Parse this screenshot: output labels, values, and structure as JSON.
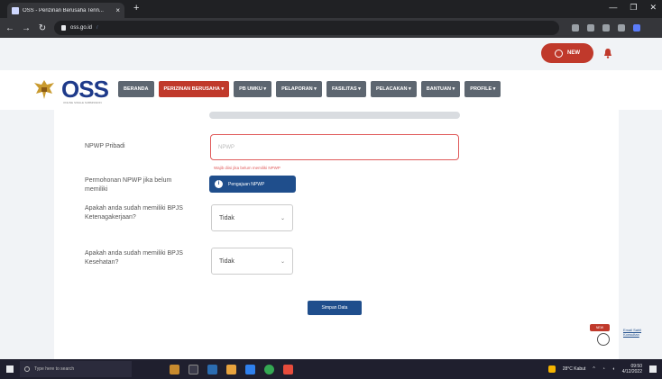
{
  "browser": {
    "tab_title": "OSS - Perizinan Berusaha Terin...",
    "url": "oss.go.id",
    "url_rest": "/"
  },
  "header": {
    "new_badge_label": "NEW",
    "logo_text": "OSS",
    "logo_subtitle": "ONLINE SINGLE SUBMISSION",
    "menu": [
      {
        "label": "BERANDA",
        "active": false
      },
      {
        "label": "PERIZINAN BERUSAHA",
        "active": true
      },
      {
        "label": "PB UMKU",
        "active": false
      },
      {
        "label": "PELAPORAN",
        "active": false
      },
      {
        "label": "FASILITAS",
        "active": false
      },
      {
        "label": "PELACAKAN",
        "active": false
      },
      {
        "label": "BANTUAN",
        "active": false
      },
      {
        "label": "PROFILE",
        "active": false
      }
    ]
  },
  "form": {
    "npwp_label": "NPWP Pribadi",
    "npwp_placeholder": "NPWP",
    "npwp_error": "Wajib diisi jika belum memiliki NPWP",
    "npwp_request_label": "Permohonan NPWP jika belum memiliki",
    "npwp_request_button": "Pengajuan NPWP",
    "bpjs_tk_label": "Apakah anda sudah memiliki BPJS Ketenagakerjaan?",
    "bpjs_tk_value": "Tidak",
    "bpjs_kes_label": "Apakah anda sudah memiliki BPJS Kesehatan?",
    "bpjs_kes_value": "Tidak",
    "save_button": "Simpan Data"
  },
  "floating": {
    "tag": "NEW",
    "help_text": "Email Sahli Konsultan"
  },
  "taskbar": {
    "search_placeholder": "Type here to search",
    "weather": "28°C Kabut",
    "time": "09:50",
    "date": "4/12/2022"
  },
  "colors": {
    "brand_red": "#c0392b",
    "brand_blue": "#1f4e8c",
    "menu_gray": "#5d6670",
    "error_red": "#e05a5a"
  }
}
